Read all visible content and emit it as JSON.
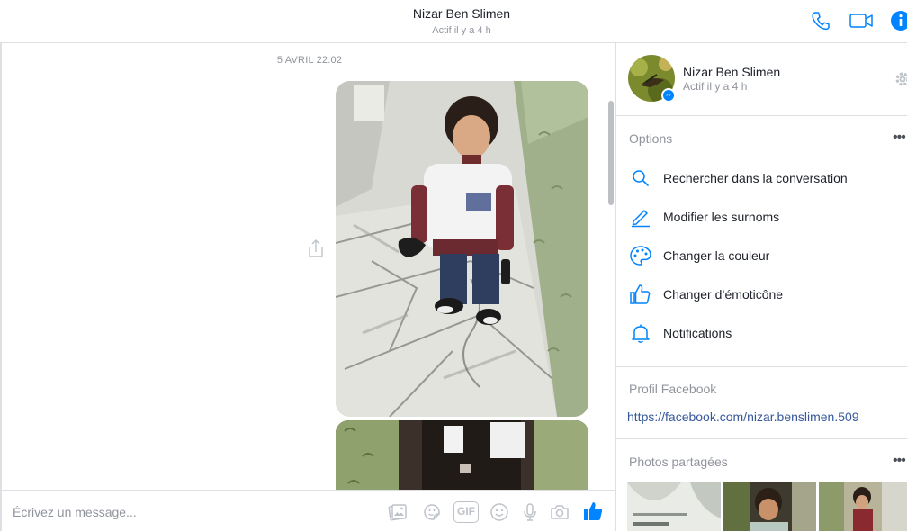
{
  "header": {
    "contact_name": "Nizar Ben Slimen",
    "status": "Actif il y a 4 h",
    "icons": [
      "phone-icon",
      "video-camera-icon",
      "info-icon"
    ]
  },
  "conversation": {
    "date_divider": "5 AVRIL 22:02",
    "messages": [
      {
        "type": "photo",
        "from": "me",
        "subject": "boy-in-marble-hallway"
      },
      {
        "type": "photo",
        "from": "me",
        "subject": "doorway-photo-partial"
      }
    ]
  },
  "composer": {
    "placeholder": "Écrivez un message...",
    "value": "",
    "icons": [
      "gallery-icon",
      "sticker-icon",
      "gif-icon",
      "emoji-icon",
      "microphone-icon",
      "camera-icon",
      "thumbs-up-icon"
    ],
    "gif_label": "GIF"
  },
  "panel": {
    "name": "Nizar Ben Slimen",
    "status": "Actif il y a 4 h",
    "options_title": "Options",
    "options": [
      {
        "label": "Rechercher dans la conversation",
        "icon": "search-icon"
      },
      {
        "label": "Modifier les surnoms",
        "icon": "pencil-icon"
      },
      {
        "label": "Changer la couleur",
        "icon": "palette-icon"
      },
      {
        "label": "Changer d’émoticône",
        "icon": "thumbs-up-icon"
      },
      {
        "label": "Notifications",
        "icon": "bell-icon"
      }
    ],
    "profile_title": "Profil Facebook",
    "profile_link": "https://facebook.com/nizar.benslimen.509",
    "photos_title": "Photos partagées",
    "more_glyph": "•••"
  },
  "colors": {
    "accent": "#0084ff",
    "link": "#365899",
    "muted": "#90949c",
    "border": "#dddfe2"
  }
}
